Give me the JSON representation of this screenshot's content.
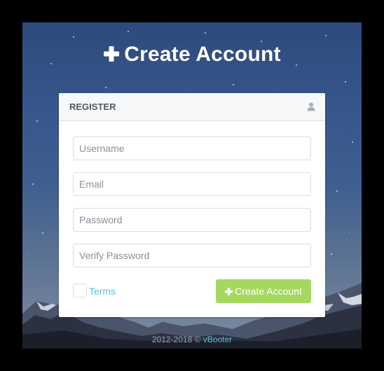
{
  "title": {
    "text": "Create Account",
    "icon": "plus-icon"
  },
  "panel": {
    "header_label": "REGISTER",
    "header_icon": "user-icon"
  },
  "form": {
    "username": {
      "placeholder": "Username",
      "value": ""
    },
    "email": {
      "placeholder": "Email",
      "value": ""
    },
    "password": {
      "placeholder": "Password",
      "value": ""
    },
    "verify_password": {
      "placeholder": "Verify Password",
      "value": ""
    },
    "terms_label": "Terms",
    "terms_checked": false,
    "submit_label": "Create Account",
    "submit_icon": "plus-icon"
  },
  "footer": {
    "text": "2012-2018 © ",
    "brand": "vBooter"
  },
  "colors": {
    "accent_green": "#a5d85e",
    "link_blue": "#5bc0de",
    "header_text": "#505a66"
  }
}
